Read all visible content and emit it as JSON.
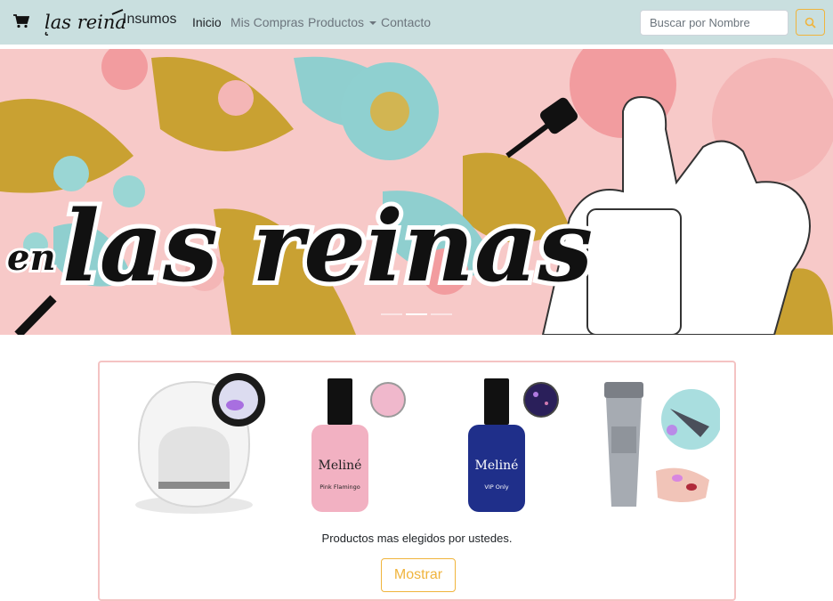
{
  "navbar": {
    "brand_logo_text": "las reinas",
    "brand_suffix": "Insumos",
    "links": [
      {
        "label": "Inicio",
        "active": true
      },
      {
        "label": "Mis Compras",
        "active": false
      },
      {
        "label": "Productos",
        "active": false,
        "dropdown": true
      },
      {
        "label": "Contacto",
        "active": false
      }
    ],
    "search": {
      "placeholder": "Buscar por Nombre",
      "value": ""
    },
    "icons": {
      "cart": "cart-icon",
      "search": "search-icon",
      "dropdown": "caret-down-icon"
    }
  },
  "banner": {
    "headline_prefix": "en",
    "headline": "las reinas",
    "slides_count": 3,
    "active_slide": 2
  },
  "featured": {
    "products": [
      {
        "name": "uv-led-lamp-egg"
      },
      {
        "name": "meline-pink-flamingo",
        "brand": "Meliné",
        "shade": "Pink Flamingo"
      },
      {
        "name": "meline-vip-only",
        "brand": "Meliné",
        "shade": "VIP Only"
      },
      {
        "name": "uv-flashlight"
      }
    ],
    "caption": "Productos mas elegidos por ustedes.",
    "button_label": "Mostrar"
  },
  "colors": {
    "navbar_bg": "#c9dfdf",
    "accent": "#f0b43c",
    "card_border": "#f4c3c3"
  }
}
